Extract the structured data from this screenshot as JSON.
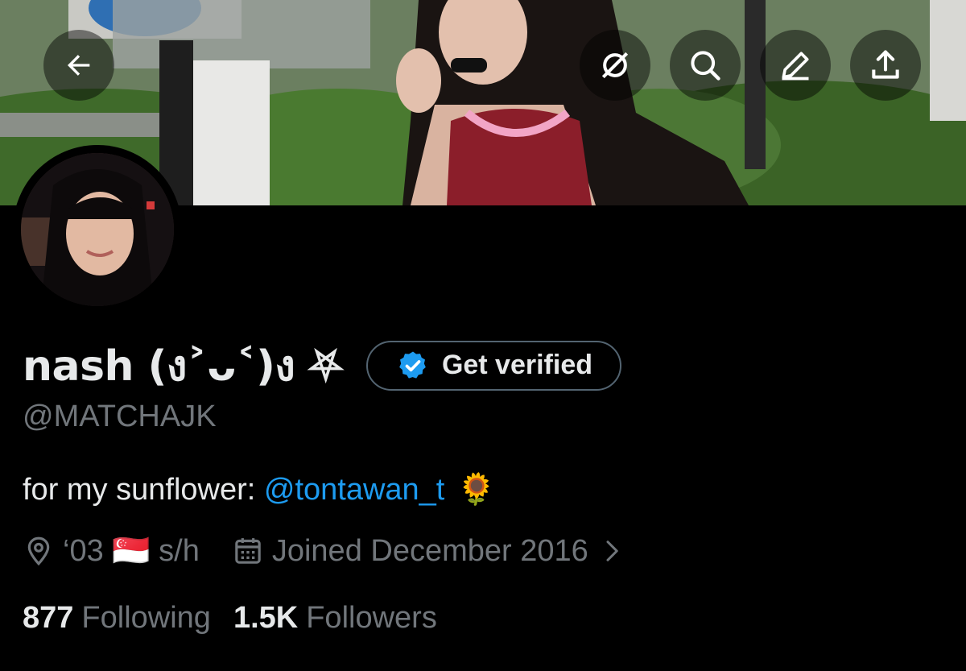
{
  "profile": {
    "display_name": "nash (ง˃ᴗ˂)ง ⛧",
    "handle": "@MATCHAJK",
    "bio_text": "for my sunflower: ",
    "bio_mention": "@tontawan_t",
    "bio_emoji": "🌻",
    "location": "‘03 🇸🇬 s/h",
    "joined": "Joined December 2016",
    "following_count": "877",
    "following_label": "Following",
    "followers_count": "1.5K",
    "followers_label": "Followers"
  },
  "actions": {
    "verify_label": "Get verified"
  },
  "icons": {
    "back": "back-arrow-icon",
    "grok": "grok-icon",
    "search": "search-icon",
    "edit": "edit-pencil-icon",
    "share": "share-icon",
    "verified": "verified-badge-icon",
    "location": "location-pin-icon",
    "calendar": "calendar-icon"
  },
  "colors": {
    "accent": "#1d9bf0",
    "muted": "#71767b",
    "text": "#e7e9ea",
    "background": "#000000"
  }
}
